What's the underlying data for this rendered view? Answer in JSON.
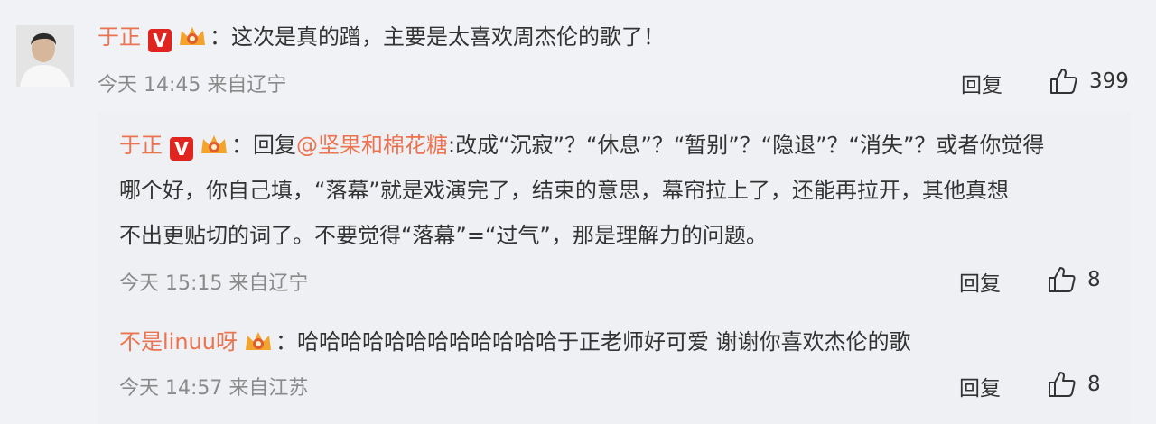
{
  "comment": {
    "user": "于正",
    "text": "：这次是真的蹭，主要是太喜欢周杰伦的歌了！",
    "time": "今天 14:45 来自辽宁",
    "reply_label": "回复",
    "likes": "399"
  },
  "replies": [
    {
      "user": "于正",
      "lines": [
        "：回复",
        "@坚果和棉花糖",
        ":改成“沉寂”？“休息”？“暂别”？“隐退”？“消失”？或者你觉得",
        "哪个好，你自己填，“落幕”就是戏演完了，结束的意思，幕帘拉上了，还能再拉开，其他真想",
        "不出更贴切的词了。不要觉得“落幕”=“过气”，那是理解力的问题。"
      ],
      "time": "今天 15:15 来自辽宁",
      "reply_label": "回复",
      "likes": "8"
    },
    {
      "user": "不是linuu呀",
      "text": "：哈哈哈哈哈哈哈哈哈哈哈哈于正老师好可爱 谢谢你喜欢杰伦的歌",
      "time": "今天 14:57 来自江苏",
      "reply_label": "回复",
      "likes": "8"
    }
  ],
  "badges": {
    "verified": "V"
  },
  "colors": {
    "username": "#eb7350",
    "verified": "#e0241f",
    "crown": "#f3a42c"
  }
}
